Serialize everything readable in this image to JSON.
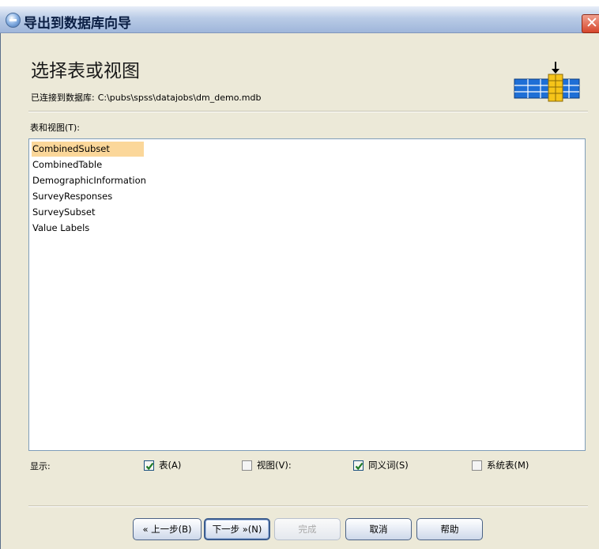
{
  "window": {
    "title": "导出到数据库向导",
    "close_glyph": "✕"
  },
  "header": {
    "heading": "选择表或视图",
    "connection_label": "已连接到数据库:",
    "connection_path": "C:\\pubs\\spss\\datajobs\\dm_demo.mdb",
    "graphic_icon": "database-export-icon"
  },
  "tables": {
    "label": "表和视图(T):",
    "items": [
      {
        "name": "CombinedSubset",
        "selected": true
      },
      {
        "name": "CombinedTable",
        "selected": false
      },
      {
        "name": "DemographicInformation",
        "selected": false
      },
      {
        "name": "SurveyResponses",
        "selected": false
      },
      {
        "name": "SurveySubset",
        "selected": false
      },
      {
        "name": "Value Labels",
        "selected": false
      }
    ]
  },
  "show": {
    "label": "显示:",
    "options": [
      {
        "label": "表(A)",
        "checked": true
      },
      {
        "label": "视图(V):",
        "checked": false
      },
      {
        "label": "同义词(S)",
        "checked": true
      },
      {
        "label": "系统表(M)",
        "checked": false
      }
    ]
  },
  "buttons": {
    "back": "« 上一步(B)",
    "next": "下一步 »(N)",
    "finish": "完成",
    "cancel": "取消",
    "help": "帮助"
  },
  "colors": {
    "selection": "#fbd79a",
    "dialog_bg": "#ece9d8",
    "title_text": "#0b1f44",
    "close_red": "#d6462c",
    "graphic_blue": "#1e6fd6",
    "graphic_yellow": "#f6c419"
  }
}
